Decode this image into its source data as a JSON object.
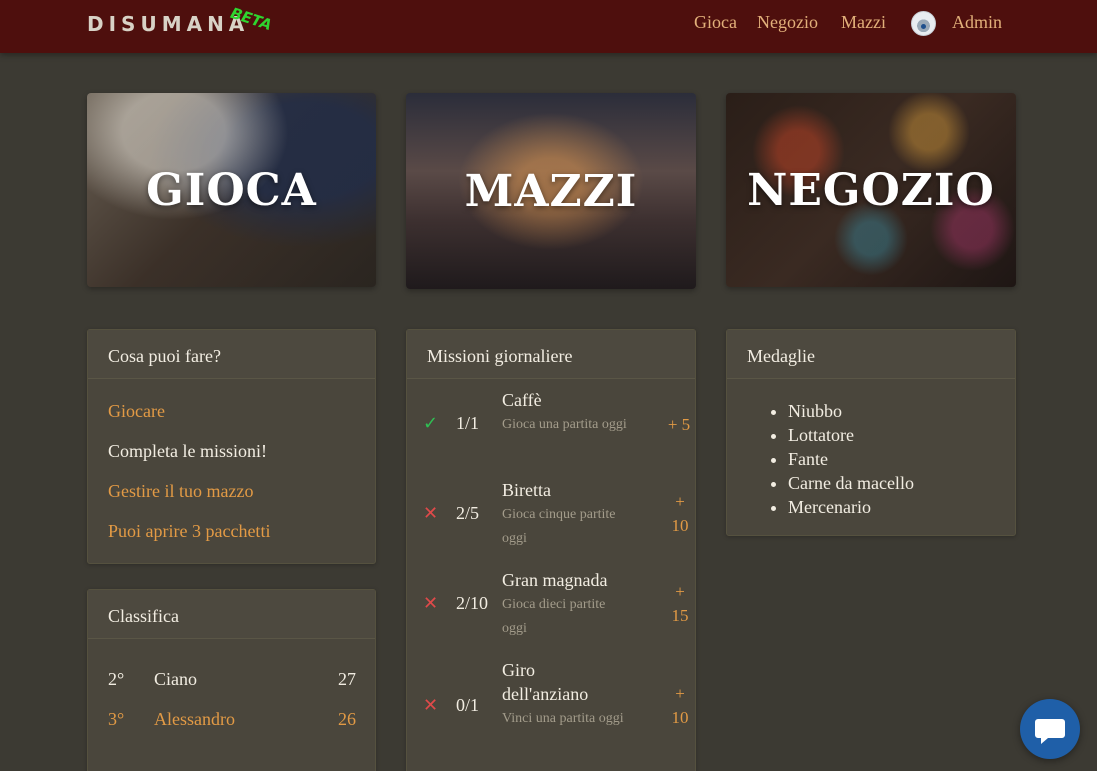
{
  "nav": {
    "brand": "DISUMANA",
    "beta": "BETA",
    "links": [
      "Gioca",
      "Negozio",
      "Mazzi"
    ],
    "user": "Admin"
  },
  "hero": {
    "gioca": "GIOCA",
    "mazzi": "MAZZI",
    "negozio": "NEGOZIO"
  },
  "todo": {
    "title": "Cosa puoi fare?",
    "items": [
      {
        "label": "Giocare",
        "color": "#e29a45"
      },
      {
        "label": "Completa le missioni!",
        "color": "#f2ede2"
      },
      {
        "label": "Gestire il tuo mazzo",
        "color": "#e29a45"
      },
      {
        "label": "Puoi aprire 3  pacchetti",
        "color": "#e29a45"
      }
    ]
  },
  "missions": {
    "title": "Missioni giornaliere",
    "items": [
      {
        "status": "done",
        "icon": "check-icon",
        "progress": "1/1",
        "name": "Caffè",
        "desc": "Gioca una partita oggi",
        "reward": "+ 5"
      },
      {
        "status": "todo",
        "icon": "cross-icon",
        "progress": "2/5",
        "name": "Biretta",
        "desc": "Gioca cinque partite oggi",
        "reward": "+ 10"
      },
      {
        "status": "todo",
        "icon": "cross-icon",
        "progress": "2/10",
        "name": "Gran magnada",
        "desc": "Gioca dieci partite oggi",
        "reward": "+ 15"
      },
      {
        "status": "todo",
        "icon": "cross-icon",
        "progress": "0/1",
        "name": "Giro dell'anziano",
        "desc": "Vinci una partita oggi",
        "reward": "+ 10"
      }
    ]
  },
  "medals": {
    "title": "Medaglie",
    "items": [
      "Niubbo",
      "Lottatore",
      "Fante",
      "Carne da macello",
      "Mercenario"
    ]
  },
  "leaderboard": {
    "title": "Classifica",
    "rows": [
      {
        "pos": "2°",
        "name": "Ciano",
        "score": "27",
        "highlight": false
      },
      {
        "pos": "3°",
        "name": "Alessandro",
        "score": "26",
        "highlight": true
      }
    ]
  },
  "colors": {
    "navbar": "#4e0f0d",
    "background": "#3c3a33",
    "accent": "#e29a45",
    "success": "#2fbf53",
    "danger": "#e04a4a",
    "chat": "#1f5fa8"
  }
}
